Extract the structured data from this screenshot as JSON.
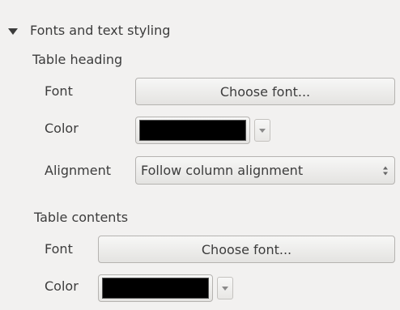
{
  "section": {
    "title": "Fonts and text styling"
  },
  "heading": {
    "title": "Table heading",
    "font_label": "Font",
    "font_button": "Choose font...",
    "color_label": "Color",
    "color_value": "#000000",
    "alignment_label": "Alignment",
    "alignment_value": "Follow column alignment"
  },
  "contents": {
    "title": "Table contents",
    "font_label": "Font",
    "font_button": "Choose font...",
    "color_label": "Color",
    "color_value": "#000000"
  },
  "icons": {
    "collapse": "triangle-down-icon",
    "dropdown": "chevron-down-icon",
    "spin": "up-down-arrows-icon"
  }
}
